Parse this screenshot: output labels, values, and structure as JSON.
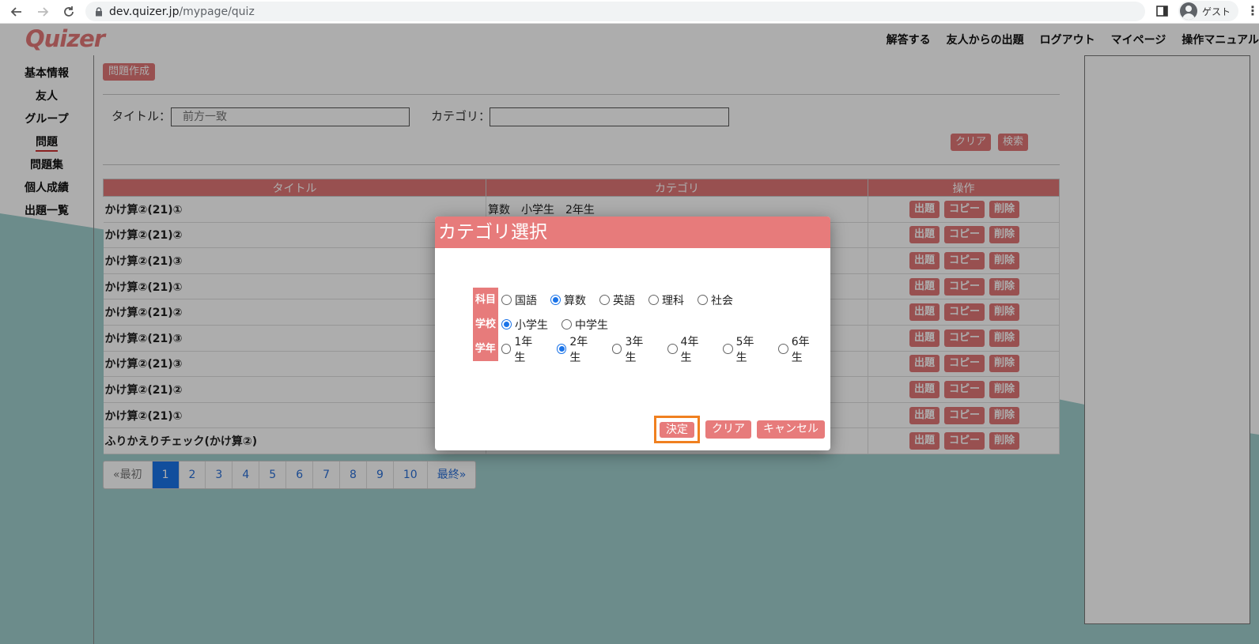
{
  "browser": {
    "url_host": "dev.quizer.jp",
    "url_path": "/mypage/quiz",
    "profile_label": "ゲスト"
  },
  "site": {
    "logo": "Quizer",
    "nav": [
      "解答する",
      "友人からの出題",
      "ログアウト",
      "マイページ",
      "操作マニュアル"
    ]
  },
  "sidebar": {
    "items": [
      {
        "label": "基本情報"
      },
      {
        "label": "友人"
      },
      {
        "label": "グループ"
      },
      {
        "label": "問題"
      },
      {
        "label": "問題集"
      },
      {
        "label": "個人成績"
      },
      {
        "label": "出題一覧"
      }
    ],
    "active_index": 3
  },
  "main": {
    "create_button": "問題作成",
    "search": {
      "title_label": "タイトル：",
      "title_placeholder": "前方一致",
      "category_label": "カテゴリ：",
      "category_value": "",
      "clear_button": "クリア",
      "search_button": "検索"
    },
    "table": {
      "headers": [
        "タイトル",
        "カテゴリ",
        "操作"
      ],
      "rows": [
        {
          "title": "かけ算②(21)①",
          "category": "算数　小学生　2年生"
        },
        {
          "title": "かけ算②(21)②",
          "category": ""
        },
        {
          "title": "かけ算②(21)③",
          "category": ""
        },
        {
          "title": "かけ算②(21)①",
          "category": ""
        },
        {
          "title": "かけ算②(21)②",
          "category": ""
        },
        {
          "title": "かけ算②(21)③",
          "category": ""
        },
        {
          "title": "かけ算②(21)③",
          "category": ""
        },
        {
          "title": "かけ算②(21)②",
          "category": ""
        },
        {
          "title": "かけ算②(21)①",
          "category": ""
        },
        {
          "title": "ふりかえりチェック(かけ算②)",
          "category": ""
        }
      ],
      "row_actions": [
        "出題",
        "コピー",
        "削除"
      ]
    },
    "pagination": {
      "first": "«最初",
      "pages": [
        "1",
        "2",
        "3",
        "4",
        "5",
        "6",
        "7",
        "8",
        "9",
        "10"
      ],
      "last": "最終»",
      "current": "1"
    }
  },
  "modal": {
    "title": "カテゴリ選択",
    "subject": {
      "label": "科目",
      "options": [
        "国語",
        "算数",
        "英語",
        "理科",
        "社会"
      ],
      "selected": "算数"
    },
    "school": {
      "label": "学校",
      "options": [
        "小学生",
        "中学生"
      ],
      "selected": "小学生"
    },
    "grade": {
      "label": "学年",
      "options": [
        "1年生",
        "2年生",
        "3年生",
        "4年生",
        "5年生",
        "6年生"
      ],
      "selected": "2年生"
    },
    "buttons": {
      "decide": "決定",
      "clear": "クリア",
      "cancel": "キャンセル"
    }
  },
  "colors": {
    "accent": "#e07676",
    "modal_header": "#e77b7b",
    "background_wave": "#6a9b9a",
    "highlight_border": "#f08020",
    "pager_active": "#1a73e8"
  }
}
